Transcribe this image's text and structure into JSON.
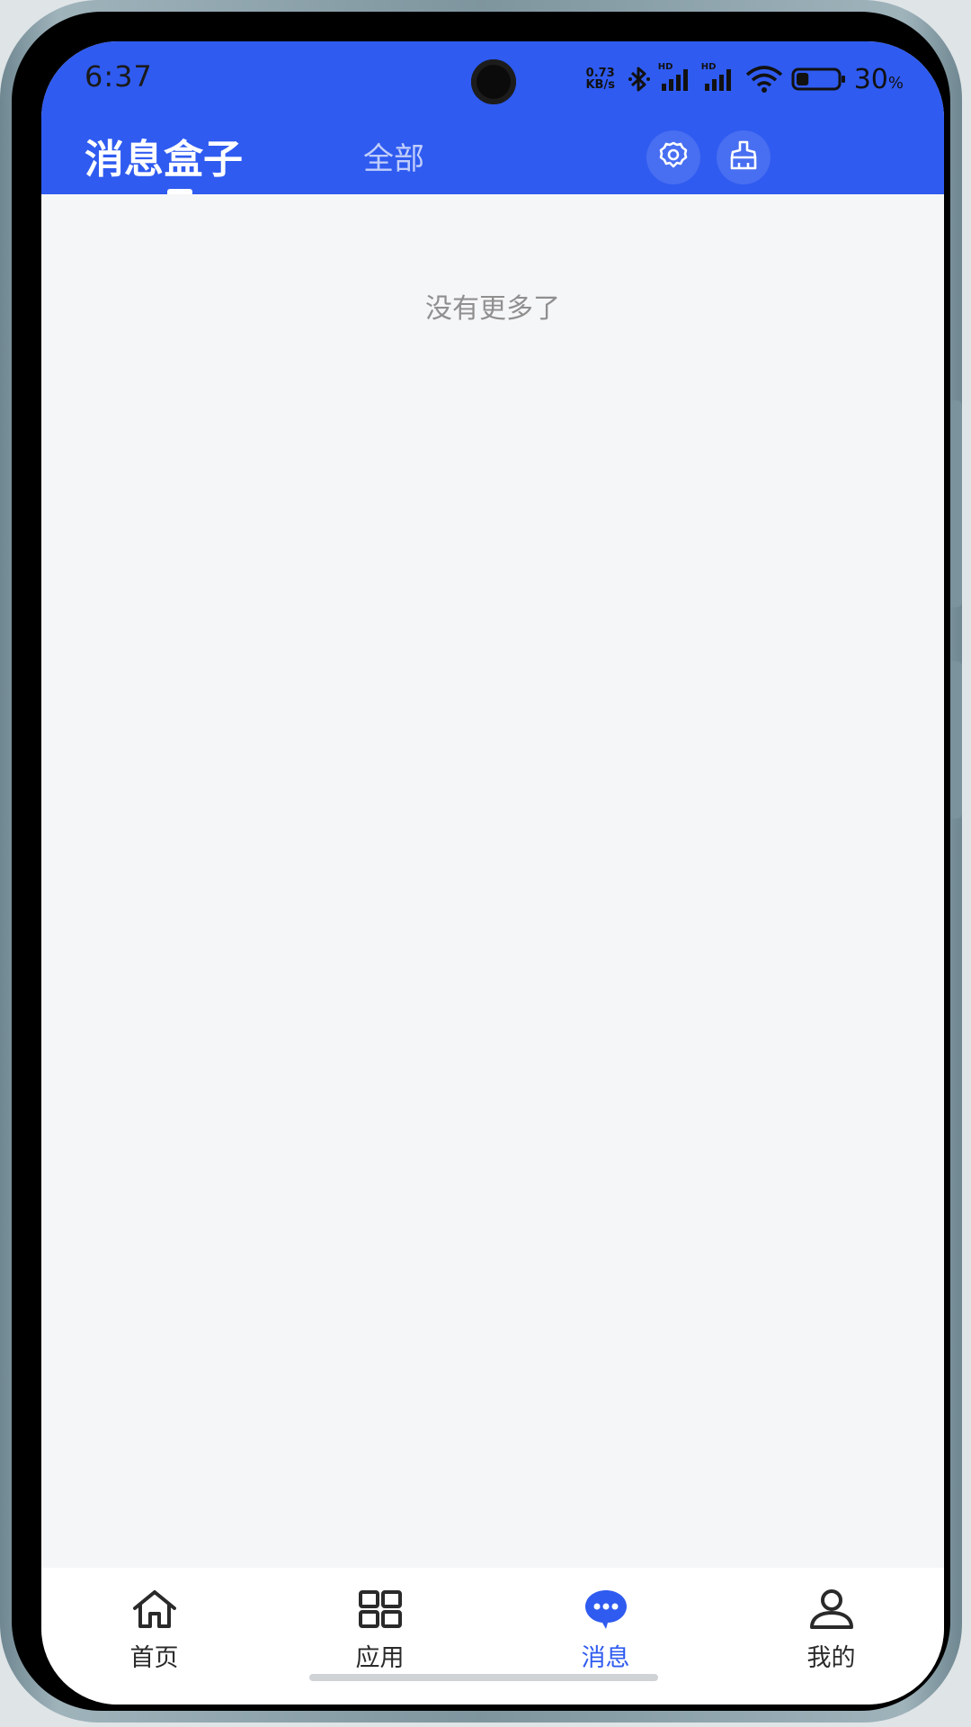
{
  "status_bar": {
    "time": "6:37",
    "net_speed_value": "0.73",
    "net_speed_unit": "KB/s",
    "signal_1_label": "HD",
    "signal_2_label": "HD",
    "battery_percent": "30",
    "battery_percent_sign": "%",
    "battery_level": 0.3,
    "icons": [
      "bluetooth-icon",
      "cellular-signal-icon",
      "cellular-signal-icon",
      "wifi-icon",
      "battery-icon"
    ]
  },
  "header": {
    "active_tab": "消息盒子",
    "tabs": [
      {
        "label": "消息盒子",
        "active": true
      },
      {
        "label": "全部",
        "active": false
      }
    ],
    "actions": [
      {
        "icon": "settings-gear-icon"
      },
      {
        "icon": "clear-broom-icon"
      }
    ]
  },
  "content": {
    "empty_text": "没有更多了"
  },
  "bottom_nav": {
    "items": [
      {
        "label": "首页",
        "icon": "home-icon",
        "active": false
      },
      {
        "label": "应用",
        "icon": "apps-grid-icon",
        "active": false
      },
      {
        "label": "消息",
        "icon": "message-bubble-icon",
        "active": true
      },
      {
        "label": "我的",
        "icon": "profile-icon",
        "active": false
      }
    ]
  },
  "colors": {
    "accent": "#2f5bf0",
    "background": "#f5f6f8",
    "nav_background": "#ffffff",
    "muted_text": "#8f8f8f"
  }
}
